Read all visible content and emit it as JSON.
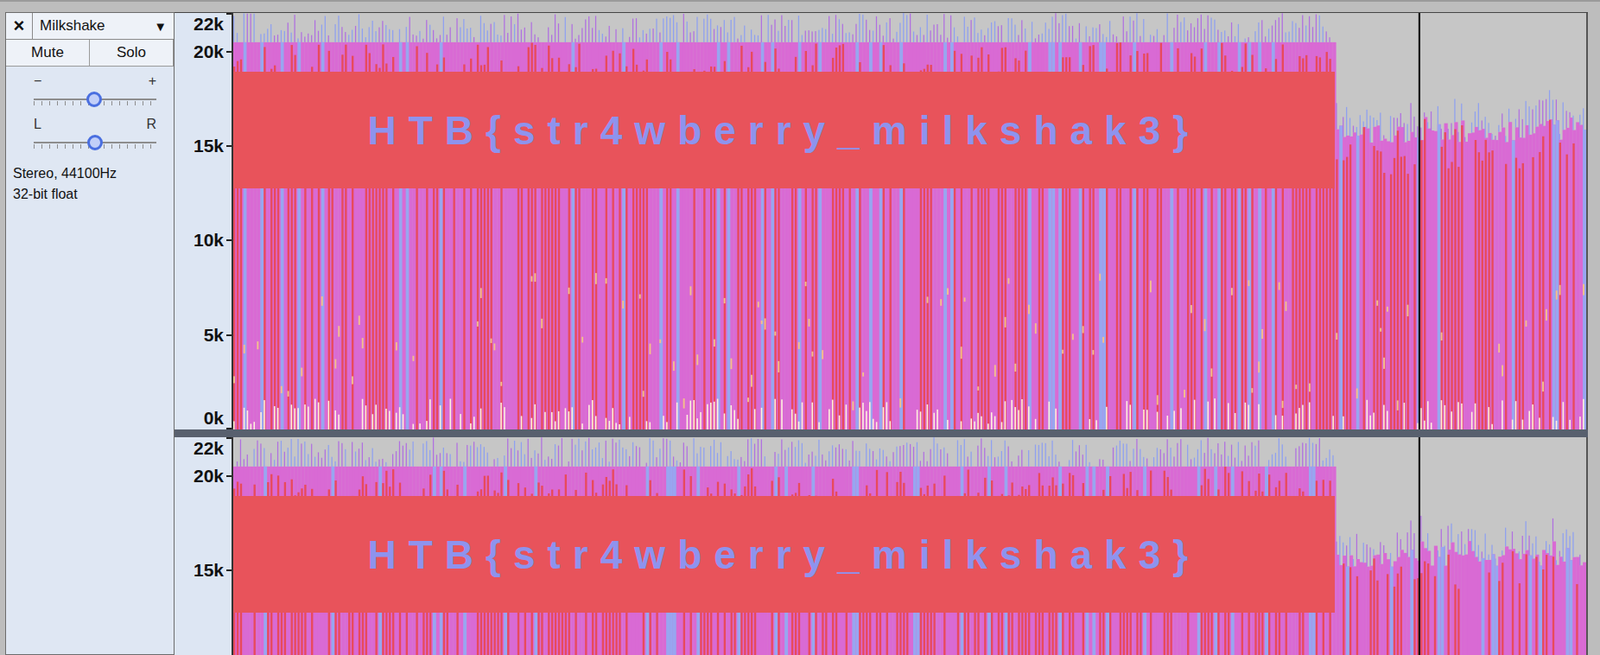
{
  "track": {
    "close": "×",
    "name": "Milkshake",
    "menu": "▼",
    "buttons": [
      {
        "label": "Mute",
        "selected": false
      },
      {
        "label": "Solo",
        "selected": false
      }
    ],
    "gain": {
      "minus": "−",
      "plus": "+",
      "level": 0.49
    },
    "pan": {
      "left": "L",
      "right": "R",
      "level": 0.5
    },
    "info": [
      "Stereo, 44100Hz",
      "32-bit float"
    ]
  },
  "channels": [
    {
      "watermark": "HTB{str4wberry_milkshak3}",
      "ticks": [
        {
          "label": "22k",
          "hz": 22050
        },
        {
          "label": "20k",
          "hz": 20000
        },
        {
          "label": "15k",
          "hz": 15000
        },
        {
          "label": "10k",
          "hz": 10000
        },
        {
          "label": "5k",
          "hz": 5000
        },
        {
          "label": "0k",
          "hz": 0
        }
      ]
    },
    {
      "watermark": "HTB{str4wberry_milkshak3}",
      "ticks": [
        {
          "label": "22k",
          "hz": 22050
        },
        {
          "label": "20k",
          "hz": 20000
        },
        {
          "label": "15k",
          "hz": 15000
        }
      ]
    }
  ]
}
